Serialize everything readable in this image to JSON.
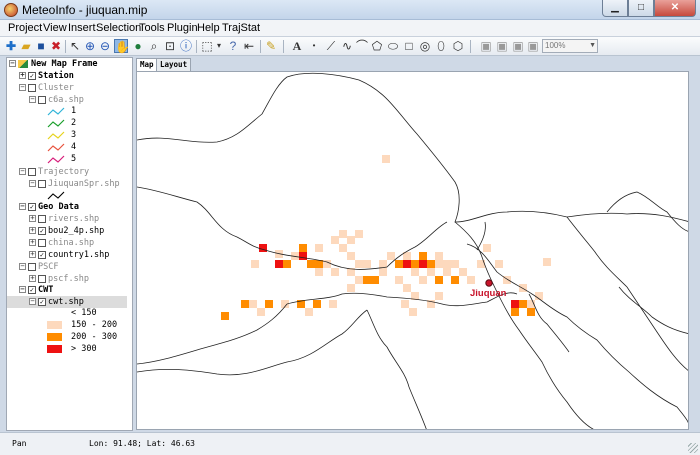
{
  "window": {
    "title": "MeteoInfo - jiuquan.mip"
  },
  "menu": [
    "Project",
    "View",
    "Insert",
    "Selection",
    "Tools",
    "Plugin",
    "Help",
    "TrajStat"
  ],
  "toolbar": {
    "zoom_value": "100%"
  },
  "tree": [
    {
      "label": "New Map Frame",
      "level": 0,
      "expander": "−",
      "checkbox": false,
      "frame": true,
      "bold": true,
      "gray": false
    },
    {
      "label": "Station",
      "level": 1,
      "expander": "+",
      "checkbox": true,
      "checked": true,
      "bold": true,
      "gray": false
    },
    {
      "label": "Cluster",
      "level": 1,
      "expander": "−",
      "checkbox": true,
      "checked": false,
      "bold": false,
      "gray": true
    },
    {
      "label": "c6a.shp",
      "level": 2,
      "expander": "−",
      "checkbox": true,
      "checked": false,
      "bold": false,
      "gray": true
    },
    {
      "label": "Trajectory",
      "level": 1,
      "expander": "−",
      "checkbox": true,
      "checked": false,
      "bold": false,
      "gray": true
    },
    {
      "label": "JiuquanSpr.shp",
      "level": 2,
      "expander": "−",
      "checkbox": true,
      "checked": false,
      "bold": false,
      "gray": true
    },
    {
      "label": "Geo Data",
      "level": 1,
      "expander": "−",
      "checkbox": true,
      "checked": true,
      "bold": true,
      "gray": false
    },
    {
      "label": "rivers.shp",
      "level": 2,
      "expander": "+",
      "checkbox": true,
      "checked": false,
      "bold": false,
      "gray": true
    },
    {
      "label": "bou2_4p.shp",
      "level": 2,
      "expander": "+",
      "checkbox": true,
      "checked": true,
      "bold": false,
      "gray": false
    },
    {
      "label": "china.shp",
      "level": 2,
      "expander": "+",
      "checkbox": true,
      "checked": false,
      "bold": false,
      "gray": true
    },
    {
      "label": "country1.shp",
      "level": 2,
      "expander": "+",
      "checkbox": true,
      "checked": true,
      "bold": false,
      "gray": false
    },
    {
      "label": "PSCF",
      "level": 1,
      "expander": "−",
      "checkbox": true,
      "checked": false,
      "bold": false,
      "gray": true
    },
    {
      "label": "pscf.shp",
      "level": 2,
      "expander": "+",
      "checkbox": true,
      "checked": false,
      "bold": false,
      "gray": true
    },
    {
      "label": "CWT",
      "level": 1,
      "expander": "−",
      "checkbox": true,
      "checked": true,
      "bold": true,
      "gray": false
    },
    {
      "label": "cwt.shp",
      "level": 2,
      "expander": "−",
      "checkbox": true,
      "checked": true,
      "bold": false,
      "gray": false,
      "selected": true
    }
  ],
  "cluster_legend": [
    {
      "label": "1",
      "color": "#2fb4d8"
    },
    {
      "label": "2",
      "color": "#1a9f2b"
    },
    {
      "label": "3",
      "color": "#e6d31c"
    },
    {
      "label": "4",
      "color": "#e8523d"
    },
    {
      "label": "5",
      "color": "#d81b7a"
    }
  ],
  "cwt_legend": [
    {
      "label": "< 150",
      "color": "#ffffff"
    },
    {
      "label": "150 - 200",
      "color": "#fdd9bd"
    },
    {
      "label": "200 - 300",
      "color": "#ff8c00"
    },
    {
      "label": "> 300",
      "color": "#ee1111"
    }
  ],
  "tabs": [
    {
      "label": "Map",
      "active": true
    },
    {
      "label": "Layout",
      "active": false
    }
  ],
  "map": {
    "station_label": "Jiuquan",
    "station_color": "#c8142b"
  },
  "status": {
    "mode": "Pan",
    "coords": "Lon: 91.48; Lat: 46.63"
  }
}
